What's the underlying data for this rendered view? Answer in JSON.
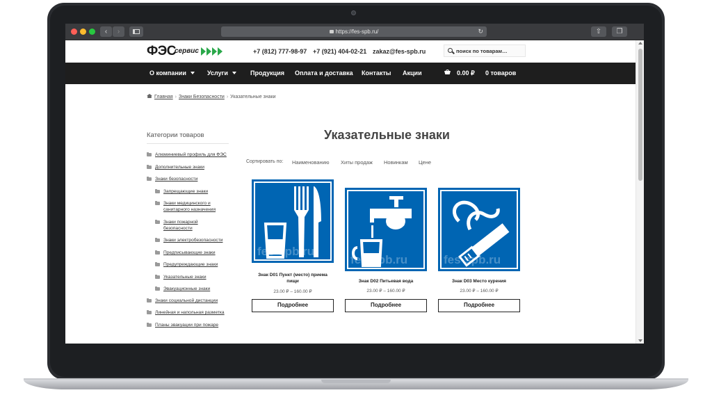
{
  "browser": {
    "url": "https://fes-spb.ru/",
    "back_glyph": "‹",
    "forward_glyph": "›",
    "reload_glyph": "↻",
    "share_glyph": "⇧",
    "tabs_glyph": "❐"
  },
  "header": {
    "logo_main": "ФЭС",
    "logo_sub": "сервис",
    "phone1": "+7 (812) 777-98-97",
    "phone2": "+7 (921) 404-02-21",
    "email": "zakaz@fes-spb.ru",
    "search_placeholder": "поиск по товарам…"
  },
  "nav": {
    "items": [
      {
        "label": "О компании"
      },
      {
        "label": "Услуги"
      },
      {
        "label": "Продукция"
      },
      {
        "label": "Оплата и доставка"
      },
      {
        "label": "Контакты"
      },
      {
        "label": "Акции"
      }
    ],
    "cart_total": "0.00 ₽",
    "cart_count": "0 товаров"
  },
  "breadcrumb": {
    "home": "Главная",
    "section": "Знаки Безопасности",
    "current": "Указательные знаки",
    "sep": "›"
  },
  "sidebar": {
    "title": "Категории товаров",
    "categories": [
      {
        "label": "Алюминиевый профиль для ФЭС"
      },
      {
        "label": "Дополнительные знаки"
      },
      {
        "label": "Знаки безопасности"
      },
      {
        "label": "Запрещающие знаки"
      },
      {
        "label": "Знаки медицинского и"
      },
      {
        "label": "санитарного назначения"
      },
      {
        "label": "Знаки пожарной"
      },
      {
        "label": "безопасности"
      },
      {
        "label": "Знаки электробезопасности"
      },
      {
        "label": "Предписывающие знаки"
      },
      {
        "label": "Предупреждающие знаки"
      },
      {
        "label": "Указательные знаки"
      },
      {
        "label": "Эвакуационные знаки"
      },
      {
        "label": "Знаки социальной дистанции"
      },
      {
        "label": "Линейная и напольная разметка"
      },
      {
        "label": "Планы эвакуации при пожаре"
      }
    ]
  },
  "main": {
    "title": "Указательные знаки",
    "sort_label": "Сортировать по:",
    "sort_options": [
      "Наименованию",
      "Хиты продаж",
      "Новинкам",
      "Цене"
    ],
    "products": [
      {
        "name_line1": "Знак D01 Пункт (место) приема",
        "name_line2": "пищи",
        "price": "23.00 ₽ – 160.00 ₽",
        "button": "Подробнее",
        "watermark": "fes-spb.ru",
        "icon": "food-icon"
      },
      {
        "name_line1": "Знак D02 Питьевая вода",
        "name_line2": "",
        "price": "23.00 ₽ – 160.00 ₽",
        "button": "Подробнее",
        "watermark": "fes-spb.ru",
        "icon": "drinking-water-icon"
      },
      {
        "name_line1": "Знак D03 Место курения",
        "name_line2": "",
        "price": "23.00 ₽ – 160.00 ₽",
        "button": "Подробнее",
        "watermark": "fes-spb.ru",
        "icon": "smoking-area-icon"
      }
    ]
  },
  "colors": {
    "sign_blue": "#0065b3",
    "navbar": "#1e1e1e",
    "logo_green": "#2aa84a"
  }
}
